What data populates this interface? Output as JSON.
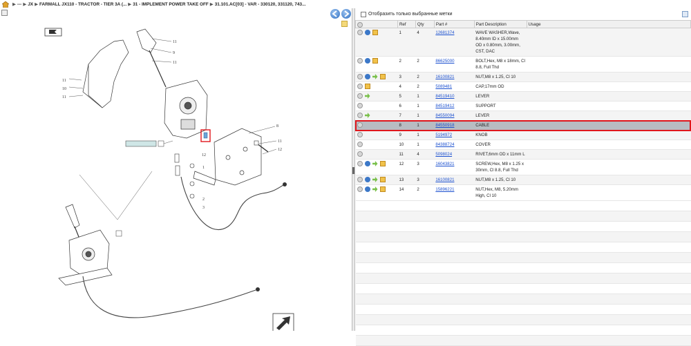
{
  "breadcrumb": {
    "items": [
      "---",
      "JX",
      "FARMALL JX110 - TRACTOR - TIER 3A (...",
      "31 - IMPLEMENT POWER TAKE OFF",
      "31.101.AC[03] - VAR - 330120, 331120, 743..."
    ],
    "separator": "▶"
  },
  "filter": {
    "label": "Отобразить только выбранные метки"
  },
  "table": {
    "headers": {
      "ref": "Ref",
      "qty": "Qty",
      "part": "Part #",
      "desc": "Part Description",
      "usage": "Usage"
    },
    "rows": [
      {
        "ref": "1",
        "qty": "4",
        "part": "12681374",
        "desc": "WAVE WASHER,Wave, 8.40mm ID x 15.00mm OD x 0.80mm, 3.00mm, CST, DAC",
        "icons": [
          "circ",
          "info",
          "box"
        ]
      },
      {
        "ref": "2",
        "qty": "2",
        "part": "86625000",
        "desc": "BOLT,Hex, M8 x 18mm, Cl 8.8, Full Thd",
        "icons": [
          "circ",
          "info",
          "box"
        ]
      },
      {
        "ref": "3",
        "qty": "2",
        "part": "16100821",
        "desc": "NUT,M8 x 1.25, Cl 10",
        "icons": [
          "circ",
          "info",
          "arrow",
          "box"
        ]
      },
      {
        "ref": "4",
        "qty": "2",
        "part": "5089481",
        "desc": "CAP,17mm OD",
        "icons": [
          "circ",
          "box"
        ]
      },
      {
        "ref": "5",
        "qty": "1",
        "part": "84519410",
        "desc": "LEVER",
        "icons": [
          "circ",
          "arrow"
        ]
      },
      {
        "ref": "6",
        "qty": "1",
        "part": "84519412",
        "desc": "SUPPORT",
        "icons": [
          "circ"
        ]
      },
      {
        "ref": "7",
        "qty": "1",
        "part": "84550094",
        "desc": "LEVER",
        "icons": [
          "circ",
          "arrow"
        ]
      },
      {
        "ref": "8",
        "qty": "1",
        "part": "84550918",
        "desc": "CABLE",
        "icons": [
          "circ"
        ],
        "selected": true
      },
      {
        "ref": "9",
        "qty": "1",
        "part": "5194972",
        "desc": "KNOB",
        "icons": [
          "circ"
        ]
      },
      {
        "ref": "10",
        "qty": "1",
        "part": "84388724",
        "desc": "COVER",
        "icons": [
          "circ"
        ]
      },
      {
        "ref": "11",
        "qty": "4",
        "part": "5098024",
        "desc": "RIVET,6mm OD x 11mm L",
        "icons": [
          "circ"
        ]
      },
      {
        "ref": "12",
        "qty": "3",
        "part": "16043821",
        "desc": "SCREW,Hex, M8 x 1.25 x 30mm, Cl 8.8, Full Thd",
        "icons": [
          "circ",
          "info",
          "arrow",
          "box"
        ]
      },
      {
        "ref": "13",
        "qty": "3",
        "part": "16100821",
        "desc": "NUT,M8 x 1.25, Cl 10",
        "icons": [
          "circ",
          "info",
          "arrow",
          "box"
        ]
      },
      {
        "ref": "14",
        "qty": "2",
        "part": "15896221",
        "desc": "NUT,Hex, M8, 5.20mm High, Cl 10",
        "icons": [
          "circ",
          "info",
          "arrow",
          "box"
        ]
      }
    ]
  },
  "diagram": {
    "callouts": [
      "11",
      "9",
      "11",
      "11",
      "10",
      "11",
      "8",
      "11",
      "12",
      "12",
      "1",
      "2",
      "3",
      "1",
      "6",
      "7",
      "5"
    ],
    "highlighted_ref": "8"
  },
  "colors": {
    "selected_row": "#b8bcc2",
    "highlight_red": "#e0161c",
    "link": "#1a4fcf"
  }
}
